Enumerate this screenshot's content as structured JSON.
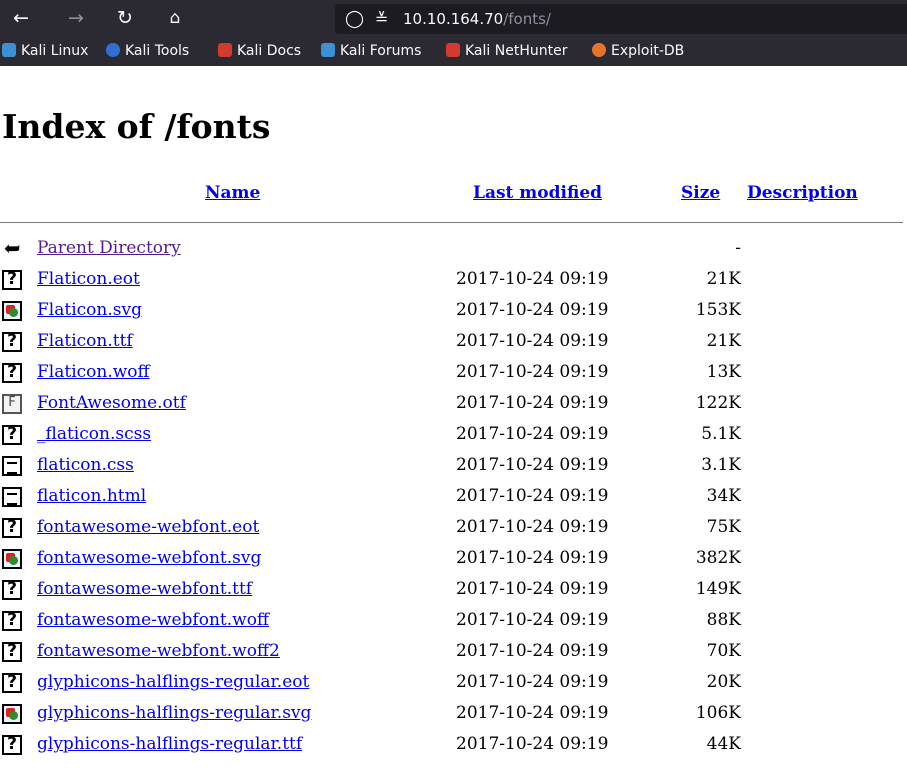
{
  "browser": {
    "url_host": "10.10.164.70",
    "url_path": "/fonts/",
    "bookmarks": [
      {
        "label": "Kali Linux",
        "color": "#3d8fd6"
      },
      {
        "label": "Kali Tools",
        "color": "#2f6fd0"
      },
      {
        "label": "Kali Docs",
        "color": "#d43a2f"
      },
      {
        "label": "Kali Forums",
        "color": "#3d8fd6"
      },
      {
        "label": "Kali NetHunter",
        "color": "#d43a2f"
      },
      {
        "label": "Exploit-DB",
        "color": "#e8742a"
      }
    ]
  },
  "page": {
    "title": "Index of /fonts",
    "columns": {
      "name": "Name",
      "last_modified": "Last modified",
      "size": "Size",
      "description": "Description"
    },
    "parent": {
      "name": "Parent Directory",
      "size": "-"
    },
    "files": [
      {
        "name": "Flaticon.eot",
        "date": "2017-10-24 09:19",
        "size": "21K",
        "icon": "unknown"
      },
      {
        "name": "Flaticon.svg",
        "date": "2017-10-24 09:19",
        "size": "153K",
        "icon": "image"
      },
      {
        "name": "Flaticon.ttf",
        "date": "2017-10-24 09:19",
        "size": "21K",
        "icon": "unknown"
      },
      {
        "name": "Flaticon.woff",
        "date": "2017-10-24 09:19",
        "size": "13K",
        "icon": "unknown"
      },
      {
        "name": "FontAwesome.otf",
        "date": "2017-10-24 09:19",
        "size": "122K",
        "icon": "font"
      },
      {
        "name": "_flaticon.scss",
        "date": "2017-10-24 09:19",
        "size": "5.1K",
        "icon": "unknown"
      },
      {
        "name": "flaticon.css",
        "date": "2017-10-24 09:19",
        "size": "3.1K",
        "icon": "text"
      },
      {
        "name": "flaticon.html",
        "date": "2017-10-24 09:19",
        "size": "34K",
        "icon": "text"
      },
      {
        "name": "fontawesome-webfont.eot",
        "date": "2017-10-24 09:19",
        "size": "75K",
        "icon": "unknown"
      },
      {
        "name": "fontawesome-webfont.svg",
        "date": "2017-10-24 09:19",
        "size": "382K",
        "icon": "image"
      },
      {
        "name": "fontawesome-webfont.ttf",
        "date": "2017-10-24 09:19",
        "size": "149K",
        "icon": "unknown"
      },
      {
        "name": "fontawesome-webfont.woff",
        "date": "2017-10-24 09:19",
        "size": "88K",
        "icon": "unknown"
      },
      {
        "name": "fontawesome-webfont.woff2",
        "date": "2017-10-24 09:19",
        "size": "70K",
        "icon": "unknown"
      },
      {
        "name": "glyphicons-halflings-regular.eot",
        "date": "2017-10-24 09:19",
        "size": "20K",
        "icon": "unknown"
      },
      {
        "name": "glyphicons-halflings-regular.svg",
        "date": "2017-10-24 09:19",
        "size": "106K",
        "icon": "image"
      },
      {
        "name": "glyphicons-halflings-regular.ttf",
        "date": "2017-10-24 09:19",
        "size": "44K",
        "icon": "unknown"
      }
    ]
  }
}
